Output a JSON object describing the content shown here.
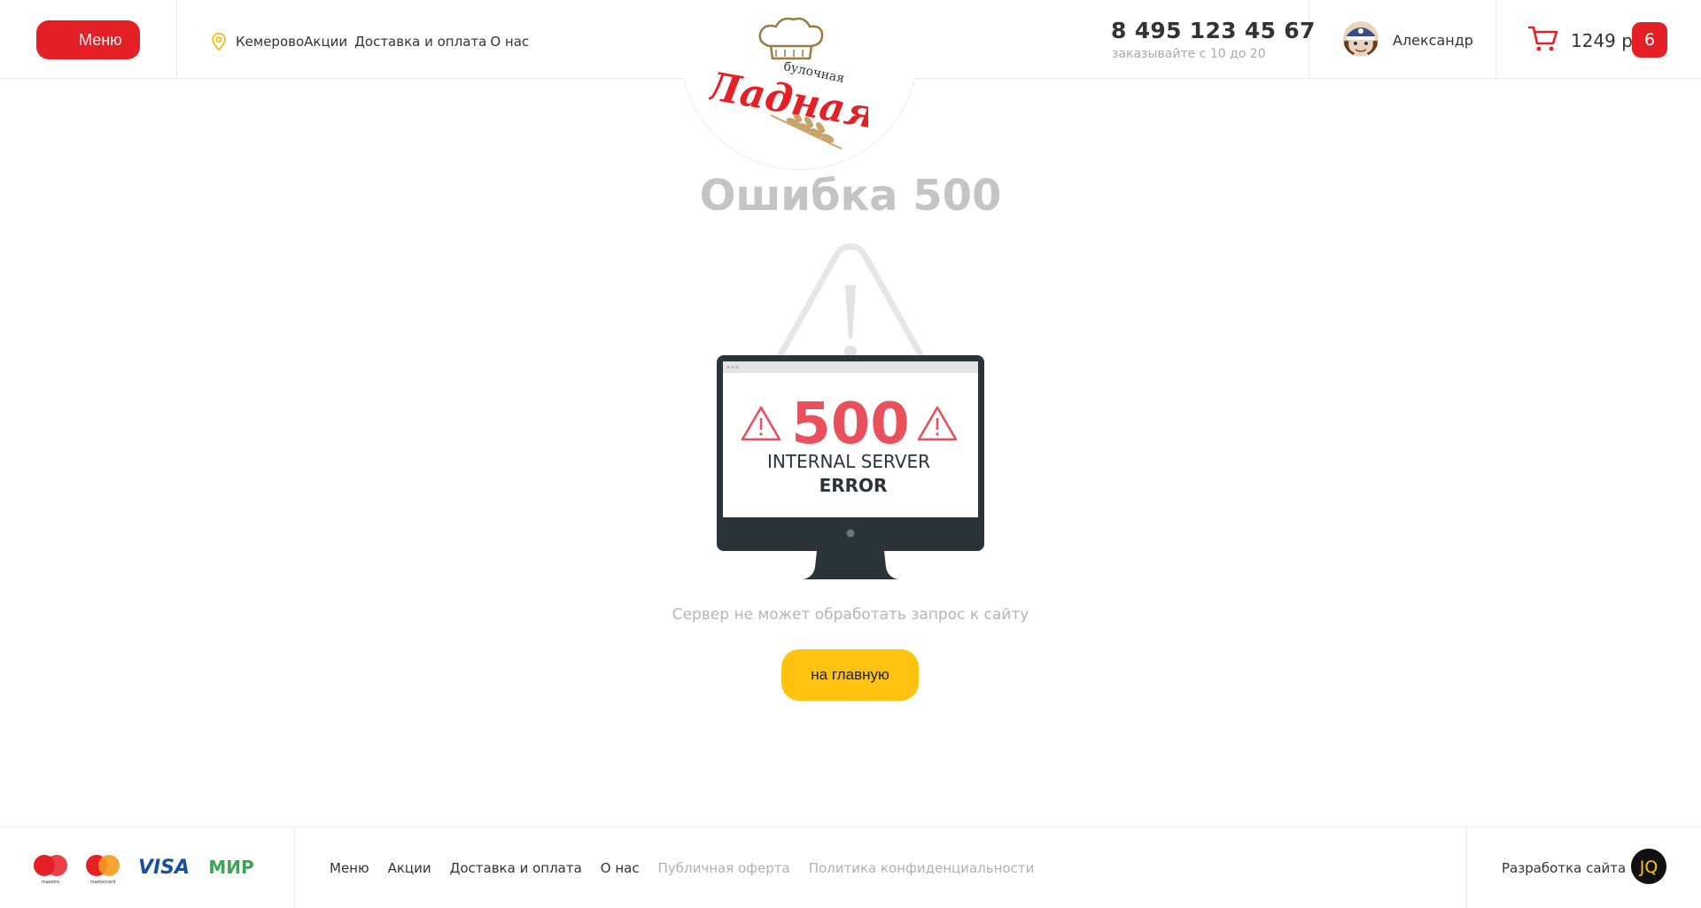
{
  "header": {
    "menu_label": "Меню",
    "city": "Кемерово",
    "nav": [
      "Акции",
      "Доставка и оплата",
      "О нас"
    ],
    "logo_small": "булочная",
    "logo_big": "Ладная",
    "phone": "8 495 123 45 67",
    "hours": "заказывайте с 10 до 20",
    "user_name": "Александр",
    "cart_sum": "1249 р",
    "cart_count": "6"
  },
  "main": {
    "title": "Ошибка 500",
    "screen_code": "500",
    "screen_line1": "INTERNAL SERVER",
    "screen_line2": "ERROR",
    "subtitle": "Сервер не может обработать запрос к сайту",
    "home_button": "на главную"
  },
  "footer": {
    "payments": [
      "maestro-icon",
      "mastercard-icon",
      "visa-icon",
      "mir-icon"
    ],
    "maestro_label": "maestro",
    "mastercard_label": "mastercard",
    "visa_label": "VISA",
    "mir_label": "МИР",
    "nav": [
      "Меню",
      "Акции",
      "Доставка и оплата",
      "О нас"
    ],
    "muted_nav": [
      "Публичная оферта",
      "Политика конфиденциальности"
    ],
    "dev_label": "Разработка сайта",
    "dev_logo_text": "JQ"
  },
  "colors": {
    "accent_red": "#e41f26",
    "accent_yellow": "#ffc20e",
    "error_red": "#e8505b",
    "monitor": "#2a3439"
  }
}
